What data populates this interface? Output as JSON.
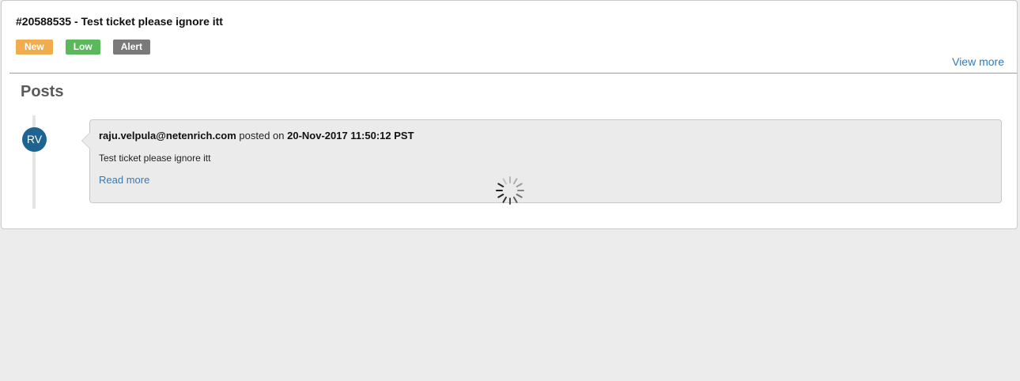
{
  "ticket": {
    "title": "#20588535 - Test ticket please ignore itt",
    "badges": [
      {
        "label": "New",
        "color": "#efad4d"
      },
      {
        "label": "Low",
        "color": "#5cb85c"
      },
      {
        "label": "Alert",
        "color": "#7a7a7a"
      }
    ],
    "view_more_label": "View more"
  },
  "posts": {
    "heading": "Posts",
    "items": [
      {
        "avatar_initials": "RV",
        "author": "raju.velpula@netenrich.com",
        "posted_on_text": " posted on ",
        "timestamp": "20-Nov-2017 11:50:12 PST",
        "body": "Test ticket please ignore itt",
        "read_more_label": "Read more"
      }
    ]
  },
  "colors": {
    "link": "#337ab7",
    "avatar_bg": "#1f6491"
  },
  "icons": {
    "loading": "loading-spinner-icon"
  }
}
